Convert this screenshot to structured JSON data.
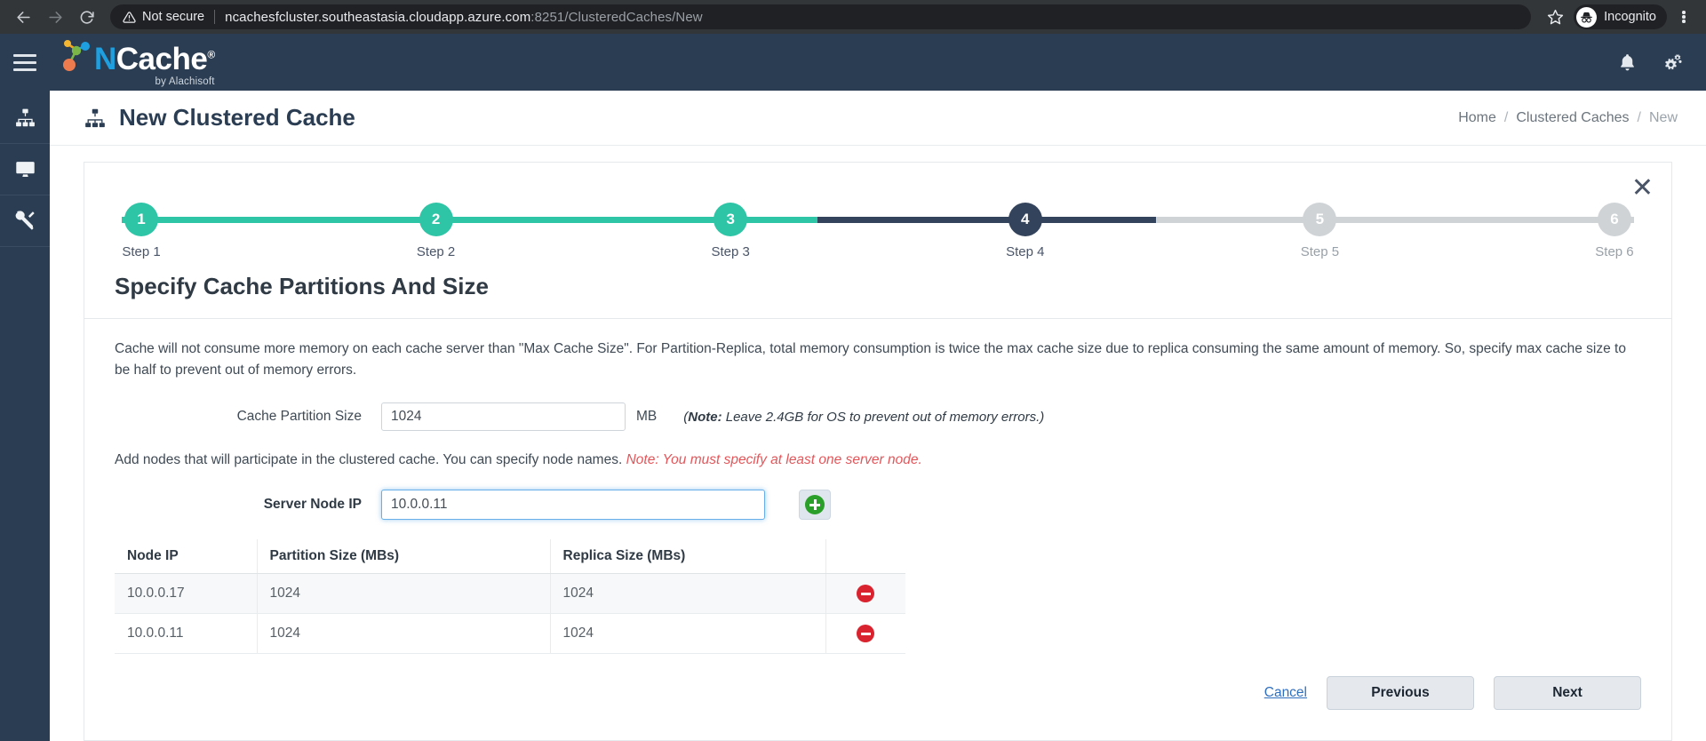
{
  "browser": {
    "back_icon": "back-arrow-icon",
    "forward_icon": "forward-arrow-icon",
    "reload_icon": "reload-icon",
    "security_label": "Not secure",
    "url_main": "ncachesfcluster.southeastasia.cloudapp.azure.com",
    "url_rest": ":8251/ClusteredCaches/New",
    "bookmark_icon": "star-icon",
    "profile_label": "Incognito",
    "menu_icon": "kebab-menu-icon"
  },
  "app_header": {
    "menu_icon": "hamburger-menu-icon",
    "logo_text_n": "N",
    "logo_text_rest": "Cache",
    "logo_registered": "®",
    "logo_sub": "by Alachisoft",
    "notifications_icon": "bell-icon",
    "settings_icon": "gears-icon"
  },
  "sidebar": {
    "items": [
      {
        "name": "clustered-caches",
        "icon": "sitemap-icon"
      },
      {
        "name": "monitor",
        "icon": "monitor-icon"
      },
      {
        "name": "tools",
        "icon": "tools-icon"
      }
    ]
  },
  "page": {
    "title": "New Clustered Cache",
    "title_icon": "sitemap-icon",
    "breadcrumb": [
      {
        "label": "Home",
        "current": false
      },
      {
        "label": "Clustered Caches",
        "current": false
      },
      {
        "label": "New",
        "current": true
      }
    ],
    "breadcrumb_separator": "/",
    "close_label": "✕"
  },
  "stepper": {
    "steps": [
      {
        "number": "1",
        "label": "Step 1",
        "state": "done"
      },
      {
        "number": "2",
        "label": "Step 2",
        "state": "done"
      },
      {
        "number": "3",
        "label": "Step 3",
        "state": "done"
      },
      {
        "number": "4",
        "label": "Step 4",
        "state": "active"
      },
      {
        "number": "5",
        "label": "Step 5",
        "state": "todo"
      },
      {
        "number": "6",
        "label": "Step 6",
        "state": "todo"
      }
    ],
    "colors": {
      "done": "#2ec4a6",
      "active": "#34435c",
      "todo": "#cfd3d6"
    }
  },
  "form": {
    "section_title": "Specify Cache Partitions And Size",
    "description": "Cache will not consume more memory on each cache server than \"Max Cache Size\". For Partition-Replica, total memory consumption is twice the max cache size due to replica consuming the same amount of memory. So, specify max cache size to be half to prevent out of memory errors.",
    "partition_size_label": "Cache Partition Size",
    "partition_size_value": "1024",
    "partition_size_unit": "MB",
    "partition_note_bold": "Note:",
    "partition_note_text": " Leave 2.4GB for OS to prevent out of memory errors.)",
    "partition_note_open": "(",
    "add_nodes_text": "Add nodes that will participate in the clustered cache. You can specify node names. ",
    "add_nodes_note": "Note: You must specify at least one server node.",
    "server_node_label": "Server Node IP",
    "server_node_value": "10.0.0.11",
    "add_button_icon": "plus-circle-icon"
  },
  "table": {
    "columns": [
      "Node IP",
      "Partition Size (MBs)",
      "Replica Size (MBs)",
      ""
    ],
    "rows": [
      {
        "ip": "10.0.0.17",
        "partition": "1024",
        "replica": "1024",
        "action_icon": "remove-circle-icon"
      },
      {
        "ip": "10.0.0.11",
        "partition": "1024",
        "replica": "1024",
        "action_icon": "remove-circle-icon"
      }
    ]
  },
  "footer": {
    "cancel_label": "Cancel",
    "previous_label": "Previous",
    "next_label": "Next"
  },
  "colors": {
    "accent_teal": "#2ec4a6",
    "navy": "#2b3d52",
    "danger_red": "#d9232e",
    "add_green": "#2aa02a",
    "note_red": "#e3565a",
    "link_blue": "#2f6fbf"
  }
}
